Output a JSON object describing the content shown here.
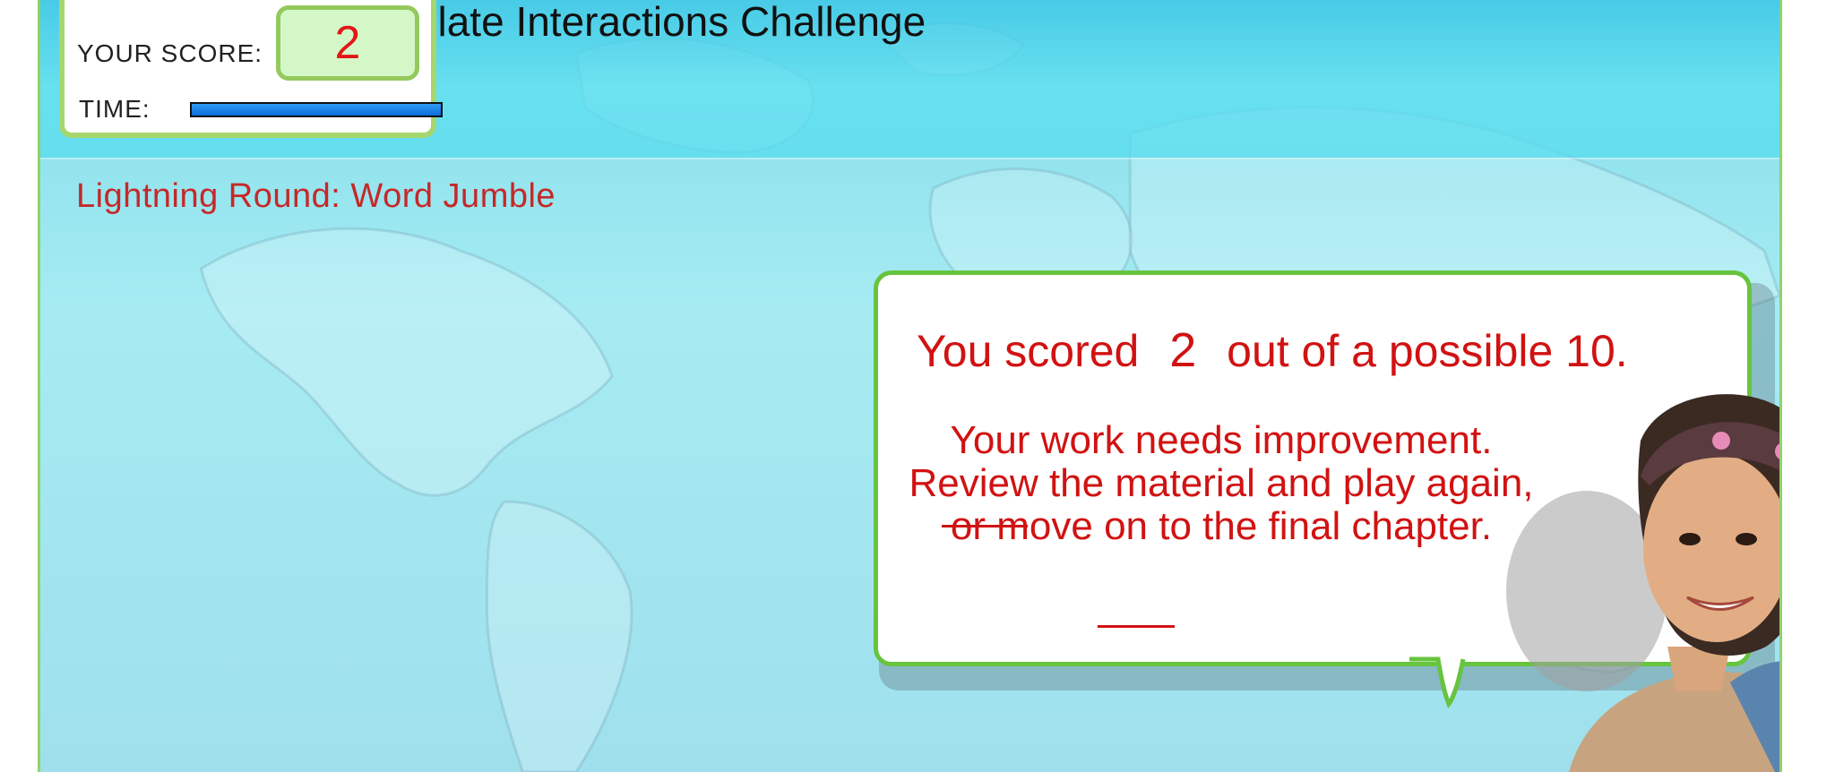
{
  "game": {
    "title": "Plate Interactions Challenge"
  },
  "score_panel": {
    "score_label": "YOUR SCORE:",
    "score_value": "2",
    "time_label": "TIME:",
    "time_remaining_fraction": 1.0
  },
  "round": {
    "title": "Lightning Round: Word Jumble"
  },
  "result": {
    "prefix": "You scored",
    "score": "2",
    "suffix": "out of a possible 10.",
    "message": "Your work needs improvement. Review the material and play again, or move on to the final chapter."
  },
  "colors": {
    "accent_green": "#67c43e",
    "text_red": "#d11212",
    "round_red": "#c62828",
    "time_bar_blue": "#0b6cd8"
  },
  "icons": {
    "guide": "guide-character-icon"
  }
}
